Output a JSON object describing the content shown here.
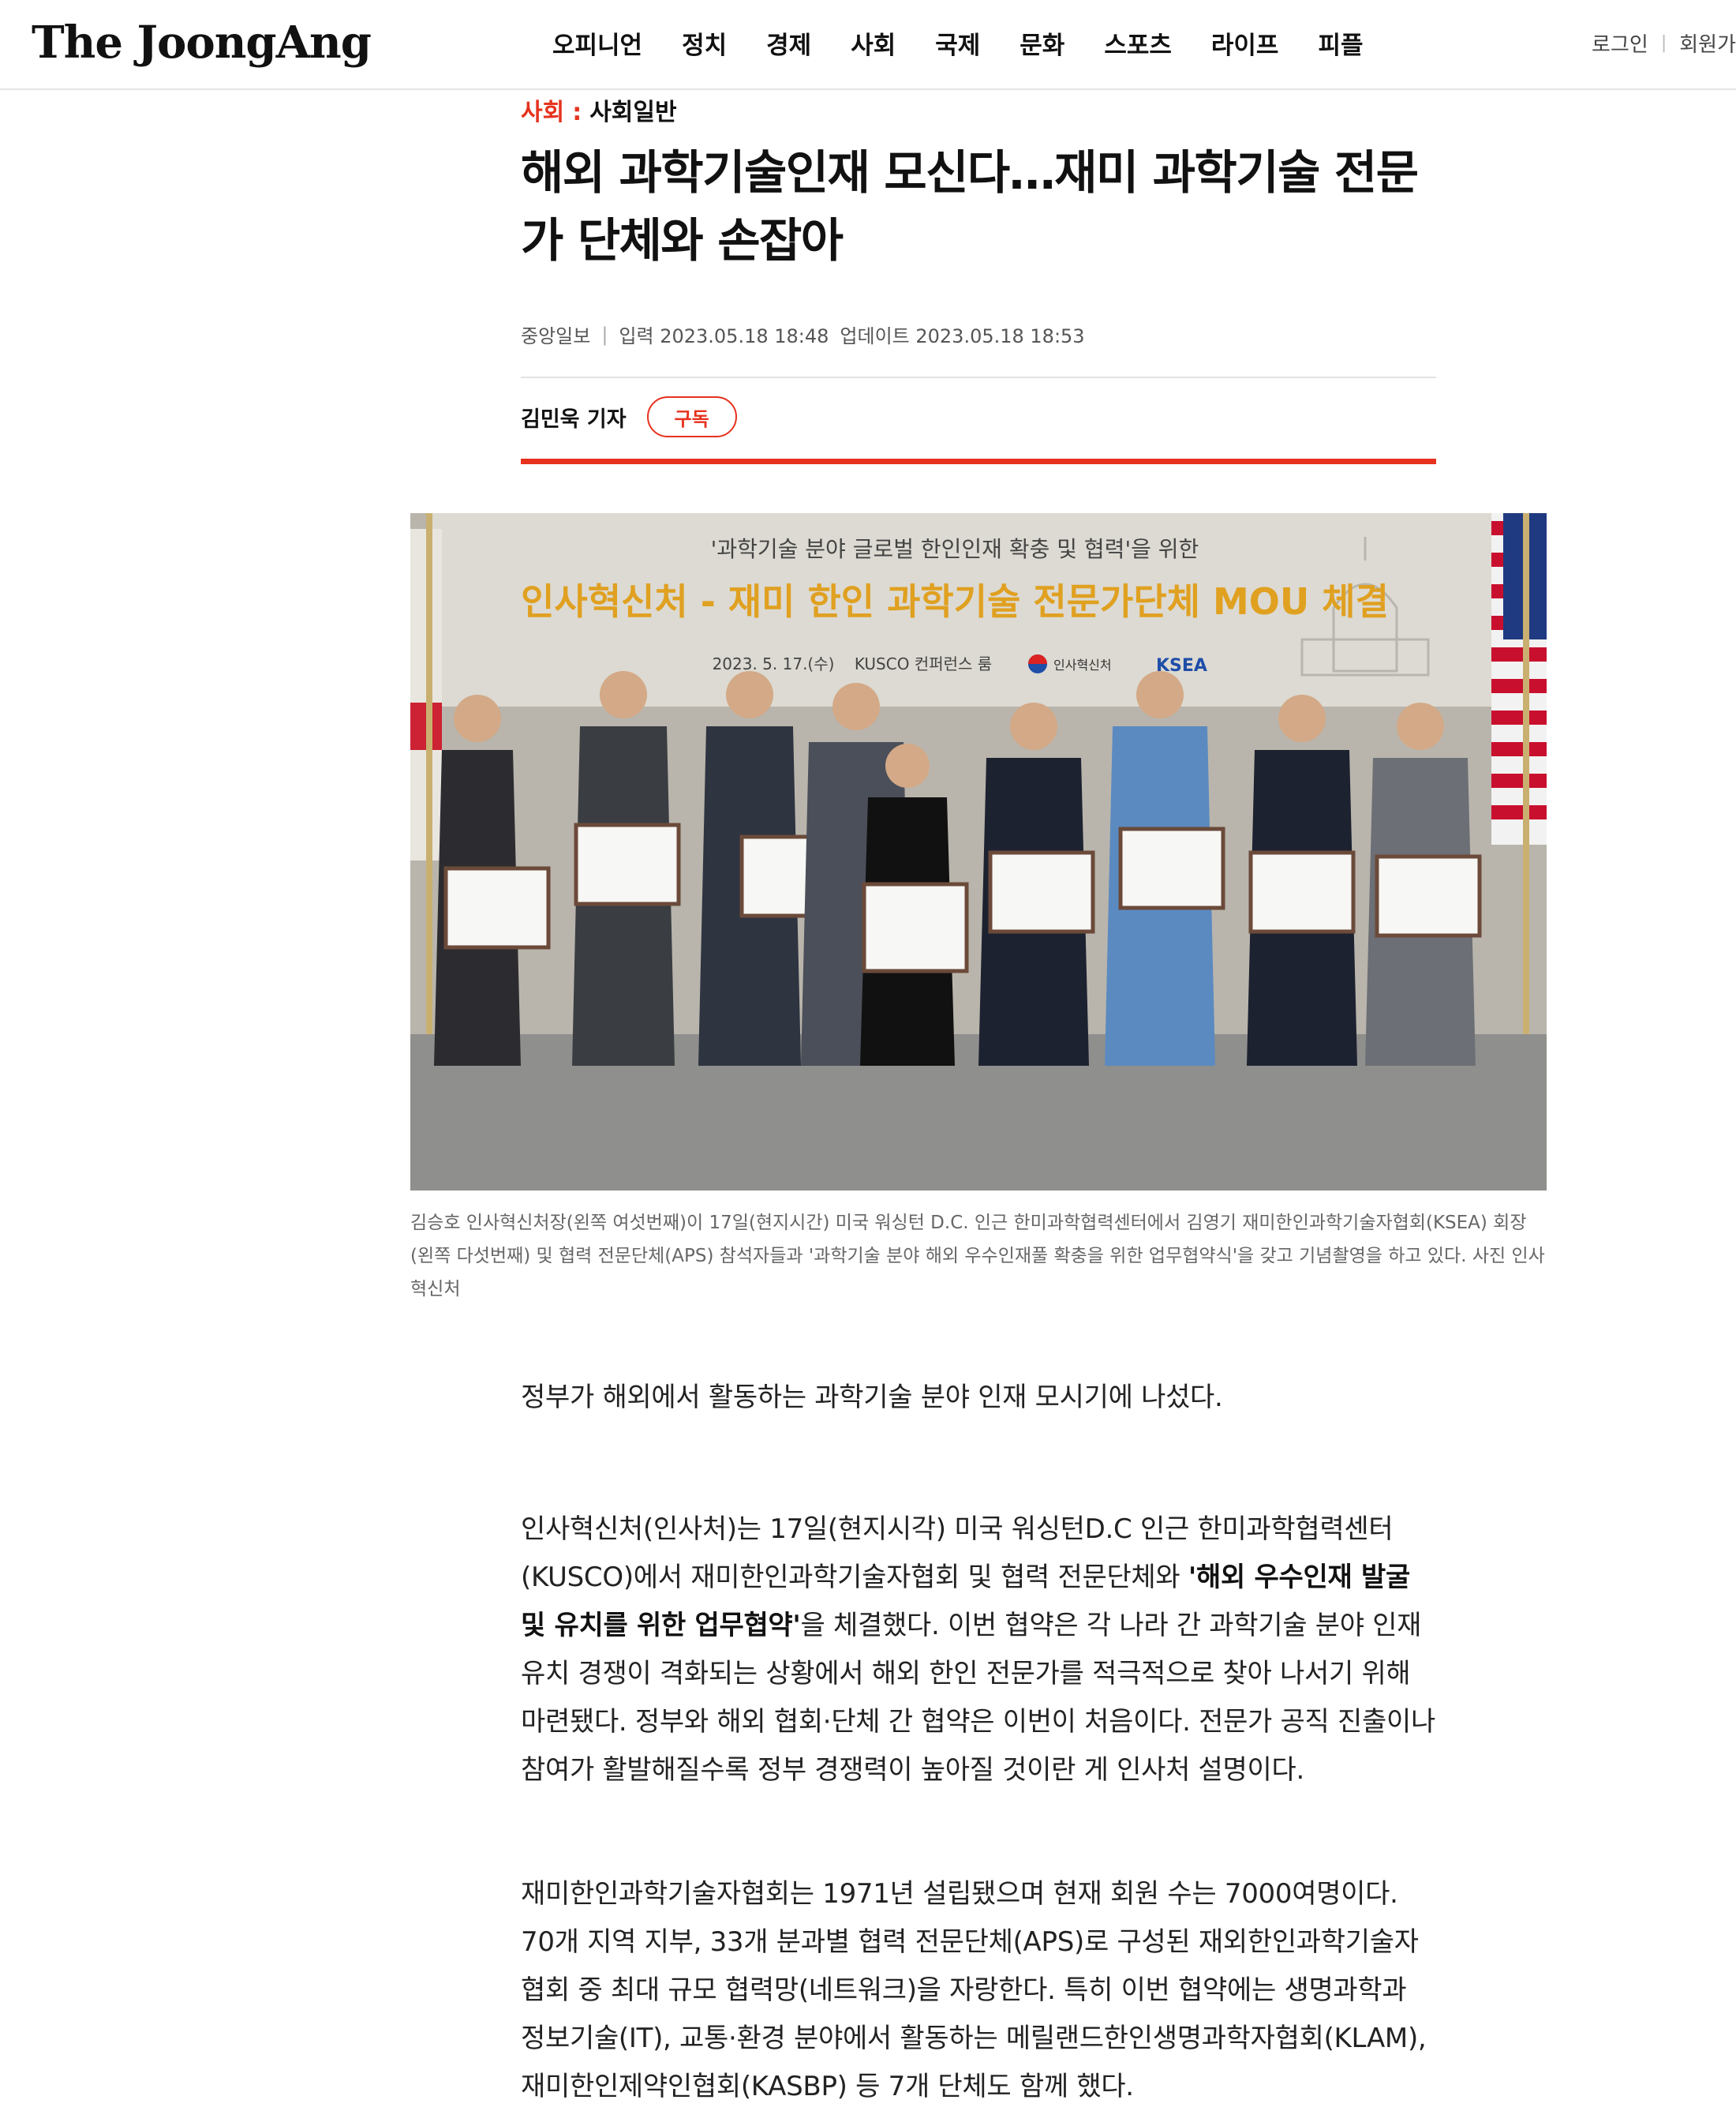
{
  "header": {
    "logo": "The JoongAng",
    "nav": [
      "오피니언",
      "정치",
      "경제",
      "사회",
      "국제",
      "문화",
      "스포츠",
      "라이프",
      "피플"
    ],
    "login": "로그인",
    "signup": "회원가"
  },
  "article": {
    "section": "사회",
    "separator": ":",
    "subsection": "사회일반",
    "headline": "해외 과학기술인재 모신다…재미 과학기술 전문가 단체와 손잡아",
    "publisher": "중앙일보",
    "input_time": "입력 2023.05.18 18:48",
    "update_time": "업데이트 2023.05.18 18:53",
    "reporter": "김민욱 기자",
    "subscribe": "구독"
  },
  "photo": {
    "banner_line1": "'과학기술 분야 글로벌 한인인재 확충 및 협력'을 위한",
    "banner_line2": "인사혁신처 - 재미 한인 과학기술 전문가단체 MOU 체결",
    "banner_line3_date": "2023. 5. 17.(수)",
    "banner_line3_venue": "KUSCO 컨퍼런스 룸",
    "logo_mpm": "인사혁신처",
    "logo_ksea": "KSEA",
    "caption": "김승호 인사혁신처장(왼쪽 여섯번째)이 17일(현지시간) 미국 워싱턴 D.C. 인근 한미과학협력센터에서 김영기 재미한인과학기술자협회(KSEA) 회장(왼쪽 다섯번째) 및 협력 전문단체(APS) 참석자들과 '과학기술 분야 해외 우수인재풀 확충을 위한 업무협약식'을 갖고 기념촬영을 하고 있다. 사진 인사혁신처"
  },
  "body": {
    "p1": "정부가 해외에서 활동하는 과학기술 분야 인재 모시기에 나섰다.",
    "p2_a": "인사혁신처(인사처)는 17일(현지시각) 미국 워싱턴D.C 인근 한미과학협력센터(KUSCO)에서 재미한인과학기술자협회 및 협력 전문단체와 ",
    "p2_bold": "'해외 우수인재 발굴 및 유치를 위한 업무협약'",
    "p2_b": "을 체결했다. 이번 협약은 각 나라 간 과학기술 분야 인재 유치 경쟁이 격화되는 상황에서 해외 한인 전문가를 적극적으로 찾아 나서기 위해 마련됐다. 정부와 해외 협회·단체 간 협약은 이번이 처음이다. 전문가 공직 진출이나 참여가 활발해질수록 정부 경쟁력이 높아질 것이란 게 인사처 설명이다.",
    "p3": "재미한인과학기술자협회는 1971년 설립됐으며 현재 회원 수는 7000여명이다. 70개 지역 지부, 33개 분과별 협력 전문단체(APS)로 구성된 재외한인과학기술자협회 중 최대 규모 협력망(네트워크)을 자랑한다. 특히 이번 협약에는 생명과학과 정보기술(IT), 교통·환경 분야에서 활동하는 메릴랜드한인생명과학자협회(KLAM), 재미한인제약인협회(KASBP) 등 7개 단체도 함께 했다."
  },
  "colors": {
    "accent": "#e6321e",
    "banner_bg": "#dcdad2",
    "banner_title": "#e0a020"
  }
}
